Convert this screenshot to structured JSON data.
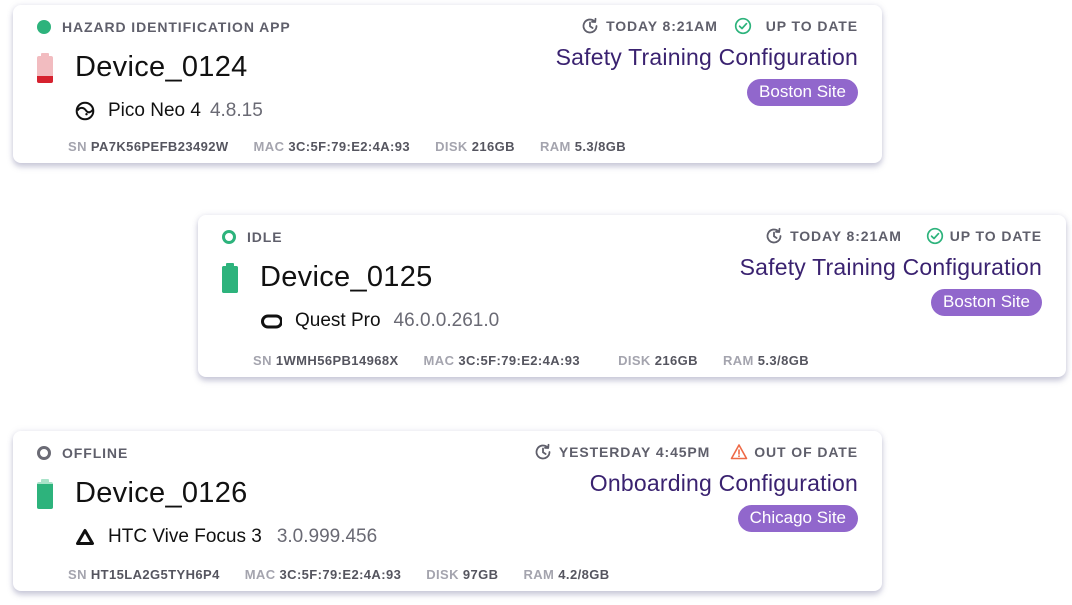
{
  "colors": {
    "online_green": "#2db37c",
    "offline_gray": "#6b6b75",
    "battery_low_red": "#d6222f",
    "battery_low_bg": "#f2bcc0",
    "battery_full_green": "#2db37c",
    "config_purple": "#3a2270",
    "site_badge_purple": "#9167cc",
    "warning_orange": "#ee6a47"
  },
  "devices": [
    {
      "status": {
        "label": "HAZARD IDENTIFICATION APP",
        "icon": "filled-dot-icon",
        "state": "active"
      },
      "battery": {
        "level_percent": 25,
        "state": "low"
      },
      "name": "Device_0124",
      "model": {
        "icon": "pico-logo-icon",
        "name": "Pico Neo 4",
        "version": "4.8.15"
      },
      "specs": [
        {
          "label": "SN",
          "value": "PA7K56PEFB23492W"
        },
        {
          "label": "MAC",
          "value": "3C:5F:79:E2:4A:93"
        },
        {
          "label": "DISK",
          "value": "216GB"
        },
        {
          "label": "RAM",
          "value": "5.3/8GB"
        }
      ],
      "last_sync": {
        "icon": "history-icon",
        "label": "TODAY 8:21AM"
      },
      "update_state": {
        "icon": "check-circle-icon",
        "label": "UP TO DATE"
      },
      "configuration": "Safety Training Configuration",
      "site": "Boston Site"
    },
    {
      "status": {
        "label": "IDLE",
        "icon": "ring-dot-icon",
        "state": "idle"
      },
      "battery": {
        "level_percent": 100,
        "state": "full"
      },
      "name": "Device_0125",
      "model": {
        "icon": "meta-quest-logo-icon",
        "name": "Quest Pro",
        "version": "46.0.0.261.0"
      },
      "specs": [
        {
          "label": "SN",
          "value": "1WMH56PB14968X"
        },
        {
          "label": "MAC",
          "value": "3C:5F:79:E2:4A:93"
        },
        {
          "label": "DISK",
          "value": "216GB"
        },
        {
          "label": "RAM",
          "value": "5.3/8GB"
        }
      ],
      "last_sync": {
        "icon": "history-icon",
        "label": "TODAY 8:21AM"
      },
      "update_state": {
        "icon": "check-circle-icon",
        "label": "UP TO DATE"
      },
      "configuration": "Safety Training Configuration",
      "site": "Boston Site"
    },
    {
      "status": {
        "label": "OFFLINE",
        "icon": "ring-dot-icon",
        "state": "offline"
      },
      "battery": {
        "level_percent": 90,
        "state": "high"
      },
      "name": "Device_0126",
      "model": {
        "icon": "htc-vive-logo-icon",
        "name": "HTC Vive Focus 3",
        "version": "3.0.999.456"
      },
      "specs": [
        {
          "label": "SN",
          "value": "HT15LA2G5TYH6P4"
        },
        {
          "label": "MAC",
          "value": "3C:5F:79:E2:4A:93"
        },
        {
          "label": "DISK",
          "value": "97GB"
        },
        {
          "label": "RAM",
          "value": "4.2/8GB"
        }
      ],
      "last_sync": {
        "icon": "history-icon",
        "label": "YESTERDAY 4:45PM"
      },
      "update_state": {
        "icon": "warning-triangle-icon",
        "label": "OUT OF DATE"
      },
      "configuration": "Onboarding Configuration",
      "site": "Chicago Site"
    }
  ]
}
